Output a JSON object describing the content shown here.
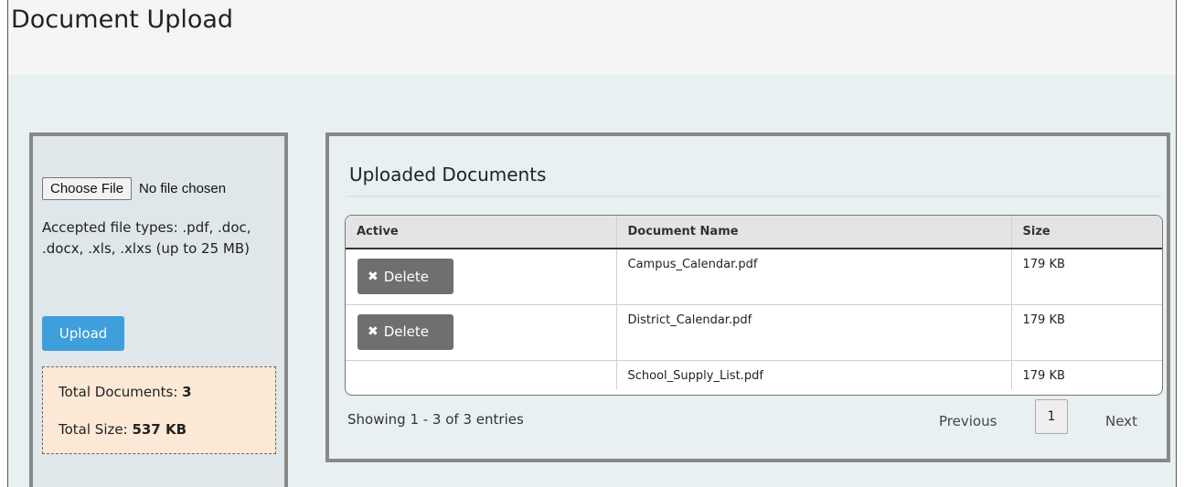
{
  "page": {
    "title": "Document Upload"
  },
  "upload_panel": {
    "choose_file_label": "Choose File",
    "no_file_text": "No file chosen",
    "accepted_text": "Accepted file types: .pdf, .doc, .docx, .xls, .xlxs (up to 25 MB)",
    "upload_label": "Upload",
    "totals": {
      "documents_label": "Total Documents:",
      "documents_value": "3",
      "size_label": "Total Size:",
      "size_value": "537 KB"
    }
  },
  "documents": {
    "title": "Uploaded Documents",
    "columns": [
      "Active",
      "Document Name",
      "Size"
    ],
    "rows": [
      {
        "delete_label": "Delete",
        "name": "Campus_Calendar.pdf",
        "size": "179 KB"
      },
      {
        "delete_label": "Delete",
        "name": "District_Calendar.pdf",
        "size": "179 KB"
      },
      {
        "delete_label": "",
        "name": "School_Supply_List.pdf",
        "size": "179 KB"
      }
    ],
    "showing_text": "Showing 1 - 3 of 3 entries",
    "pagination": {
      "previous": "Previous",
      "current": "1",
      "next": "Next"
    }
  },
  "colors": {
    "upload_button": "#3e9fdc",
    "delete_button": "#6f6f6f",
    "totals_background": "#fde9d6"
  },
  "icons": {
    "delete": "close-x-icon"
  }
}
